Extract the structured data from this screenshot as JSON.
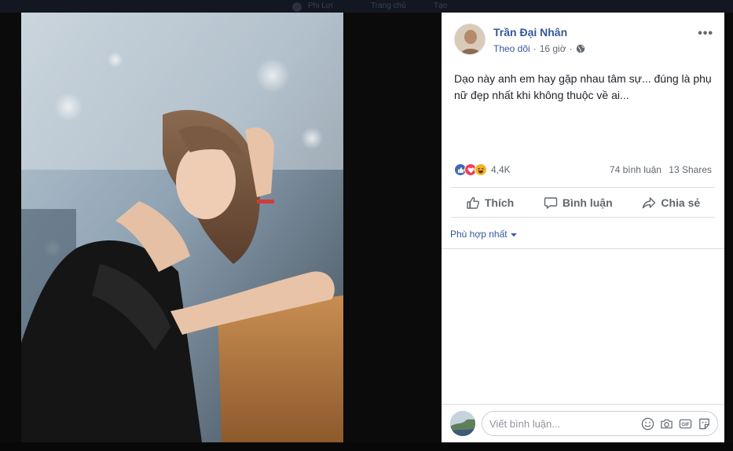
{
  "topbar": {
    "nav": [
      "Phi Lợi",
      "Trang chủ",
      "Tạo"
    ]
  },
  "post": {
    "author": "Trần Đại Nhân",
    "follow_label": "Theo dõi",
    "separator": "·",
    "time": "16 giờ",
    "privacy_icon": "globe-icon",
    "more_label": "•••",
    "text": "Dạo này anh em hay gặp nhau tâm sự... đúng là phụ nữ đẹp nhất khi không thuộc về ai..."
  },
  "stats": {
    "reaction_icons": [
      "like-reaction-icon",
      "love-reaction-icon",
      "haha-reaction-icon"
    ],
    "reaction_count": "4,4K",
    "comments": "74 bình luận",
    "shares": "13 Shares"
  },
  "actions": {
    "like": "Thích",
    "comment": "Bình luận",
    "share": "Chia sẻ"
  },
  "comments": {
    "sort_label": "Phù hợp nhất",
    "placeholder": "Viết bình luận...",
    "tools": [
      "emoji-icon",
      "camera-icon",
      "gif-icon",
      "sticker-icon"
    ]
  },
  "colors": {
    "link": "#365899",
    "text": "#1d2129",
    "muted": "#606770",
    "like": "#4267b2",
    "love": "#f33e58",
    "haha": "#f7b125"
  }
}
